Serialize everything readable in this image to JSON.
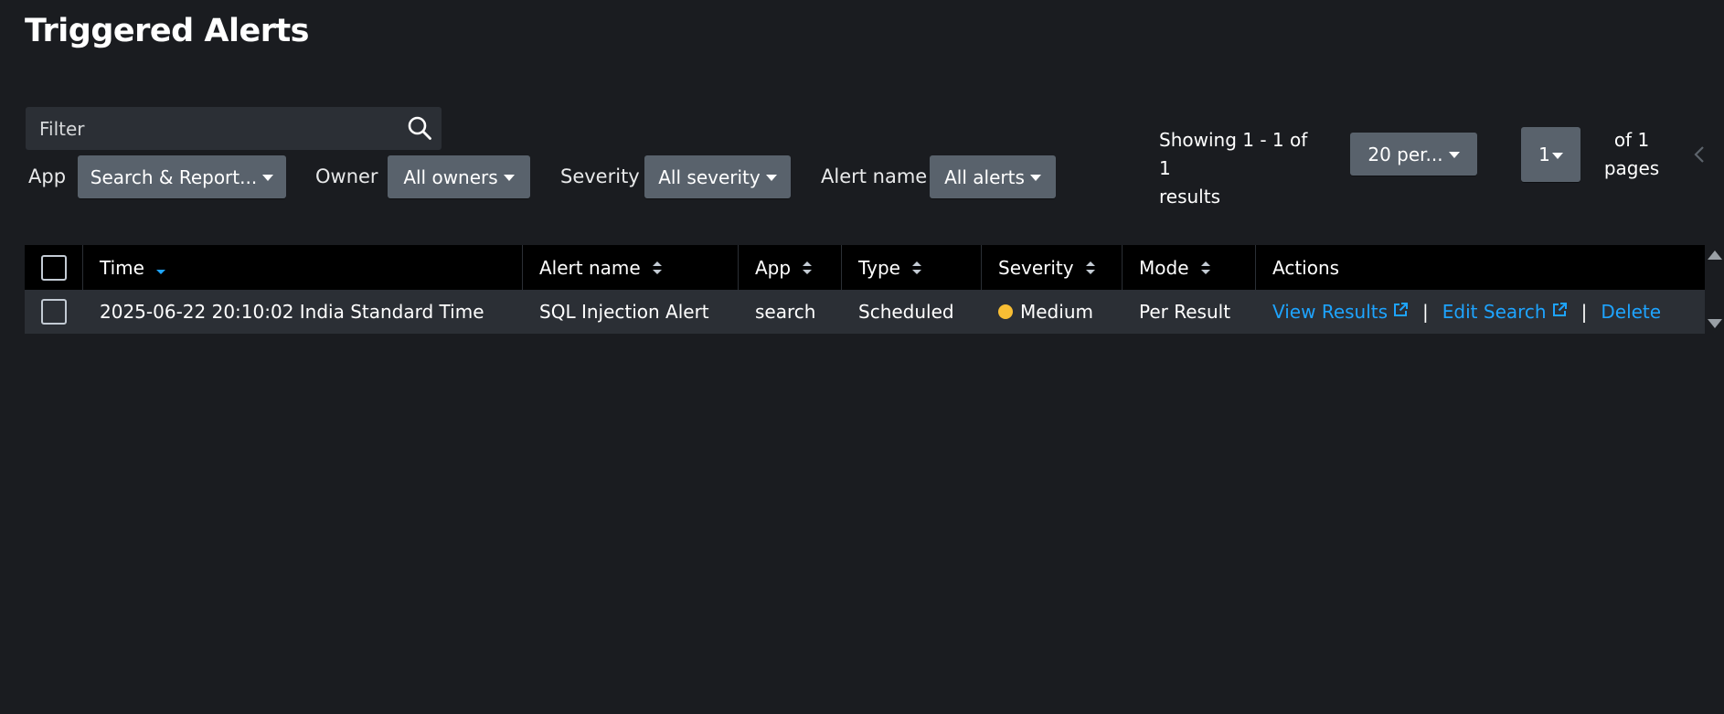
{
  "page": {
    "title": "Triggered Alerts"
  },
  "filter": {
    "placeholder": "Filter",
    "value": "",
    "icon": "search-icon"
  },
  "controls": {
    "app": {
      "label": "App",
      "value": "Search & Report..."
    },
    "owner": {
      "label": "Owner",
      "value": "All owners"
    },
    "severity": {
      "label": "Severity",
      "value": "All severity"
    },
    "alert_name": {
      "label": "Alert name",
      "value": "All alerts"
    }
  },
  "pagination": {
    "showing_line1": "Showing 1 - 1 of 1",
    "showing_line2": "results",
    "per_page": "20 per...",
    "current_page": "1",
    "of_pages_line1": "of 1",
    "of_pages_line2": "pages",
    "prev_icon": "chevron-left-icon"
  },
  "table": {
    "columns": [
      {
        "key": "time",
        "label": "Time",
        "sort": "desc"
      },
      {
        "key": "alert_name",
        "label": "Alert name",
        "sort": "both"
      },
      {
        "key": "app",
        "label": "App",
        "sort": "both"
      },
      {
        "key": "type",
        "label": "Type",
        "sort": "both"
      },
      {
        "key": "severity",
        "label": "Severity",
        "sort": "both"
      },
      {
        "key": "mode",
        "label": "Mode",
        "sort": "both"
      },
      {
        "key": "actions",
        "label": "Actions",
        "sort": "none"
      }
    ],
    "rows": [
      {
        "time": "2025-06-22 20:10:02 India Standard Time",
        "alert_name": "SQL Injection Alert",
        "app": "search",
        "type": "Scheduled",
        "severity": "Medium",
        "severity_color": "#f8be34",
        "mode": "Per Result",
        "actions": {
          "view_results": "View Results",
          "edit_search": "Edit Search",
          "delete": "Delete",
          "separator": "|"
        }
      }
    ]
  },
  "colors": {
    "background": "#1a1c20",
    "header_bg": "#000000",
    "row_bg": "#2b2f35",
    "button_bg": "#59626c",
    "link": "#1ea4ff",
    "severity_medium": "#f8be34"
  }
}
